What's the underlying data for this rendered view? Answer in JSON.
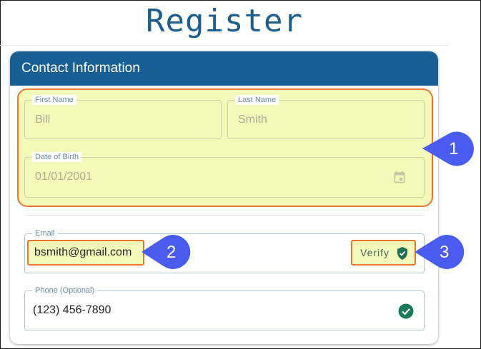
{
  "page": {
    "title": "Register"
  },
  "card": {
    "header": "Contact Information"
  },
  "fields": {
    "first_name": {
      "label": "First Name",
      "value": "Bill"
    },
    "last_name": {
      "label": "Last Name",
      "value": "Smith"
    },
    "dob": {
      "label": "Date of Birth",
      "value": "01/01/2001"
    },
    "email": {
      "label": "Email",
      "value": "bsmith@gmail.com",
      "action": "Verify"
    },
    "phone": {
      "label": "Phone (Optional)",
      "value": "(123) 456-7890"
    }
  },
  "callouts": [
    "1",
    "2",
    "3"
  ],
  "icons": {
    "dob": "calendar-icon",
    "verify": "shield-check-icon",
    "phone": "check-circle-icon"
  },
  "colors": {
    "header": "#175f94",
    "highlight_fill": "#f3f9b9",
    "highlight_border": "#e9762d",
    "callout": "#4a5cf0",
    "success": "#1a7a5a"
  }
}
